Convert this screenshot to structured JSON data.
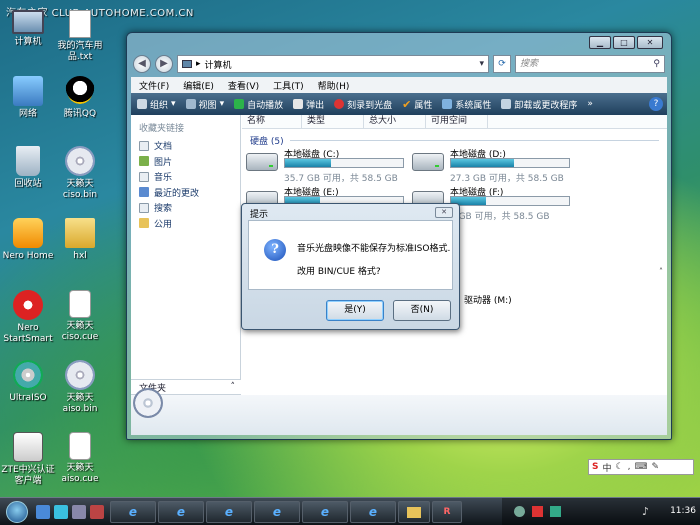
{
  "watermark": "汽车之家 CLUB.AUTOHOME.COM.CN",
  "desktop_icons": [
    {
      "label": "计算机",
      "icon": "computer-icon"
    },
    {
      "label": "我的汽车用品.txt",
      "icon": "text-file-icon"
    },
    {
      "label": "网络",
      "icon": "network-icon"
    },
    {
      "label": "腾讯QQ",
      "icon": "qq-icon"
    },
    {
      "label": "回收站",
      "icon": "recycle-bin-icon"
    },
    {
      "label": "天籁天ciso.bin",
      "icon": "disc-image-icon"
    },
    {
      "label": "Nero Home",
      "icon": "nero-home-icon"
    },
    {
      "label": "hxl",
      "icon": "folder-icon"
    },
    {
      "label": "Nero StartSmart",
      "icon": "nero-startsmart-icon"
    },
    {
      "label": "天籁天ciso.cue",
      "icon": "cue-file-icon"
    },
    {
      "label": "UltraISO",
      "icon": "ultraiso-icon"
    },
    {
      "label": "天籁天aiso.bin",
      "icon": "disc-image-icon"
    },
    {
      "label": "ZTE中兴认证客户端",
      "icon": "zte-client-icon"
    },
    {
      "label": "天籁天aiso.cue",
      "icon": "cue-file-icon"
    }
  ],
  "explorer": {
    "address": "计算机",
    "search_placeholder": "搜索",
    "menu": [
      "文件(F)",
      "编辑(E)",
      "查看(V)",
      "工具(T)",
      "帮助(H)"
    ],
    "toolbar": [
      "组织",
      "视图",
      "自动播放",
      "弹出",
      "刻录到光盘",
      "属性",
      "系统属性",
      "卸载或更改程序"
    ],
    "nav_header": "收藏夹链接",
    "nav_items": [
      "文档",
      "图片",
      "音乐",
      "最近的更改",
      "搜索",
      "公用"
    ],
    "folders_label": "文件夹",
    "columns": [
      "名称",
      "类型",
      "总大小",
      "可用空间"
    ],
    "group_label": "硬盘 (5)",
    "drives": [
      {
        "name": "本地磁盘 (C:)",
        "free": "35.7 GB 可用，共 58.5 GB",
        "used_fraction": 0.39
      },
      {
        "name": "本地磁盘 (D:)",
        "free": "27.3 GB 可用，共 58.5 GB",
        "used_fraction": 0.53
      },
      {
        "name": "本地磁盘 (E:)",
        "free": "",
        "used_fraction": 0.3
      },
      {
        "name": "本地磁盘 (F:)",
        "free": "6 GB 可用，共 58.5 GB",
        "used_fraction": 0.3
      }
    ],
    "removable_partial": "驱动器 (M:)"
  },
  "dialog": {
    "title": "提示",
    "line1": "音乐光盘映像不能保存为标准ISO格式.",
    "line2": "改用 BIN/CUE 格式?",
    "yes": "是(Y)",
    "no": "否(N)"
  },
  "taskbar": {
    "clock": "11:36"
  },
  "colors": {
    "toolbar": "#2b4d6b",
    "drive_fill": "#2aa0c8",
    "dialog_bg": "#d4e0eb"
  }
}
